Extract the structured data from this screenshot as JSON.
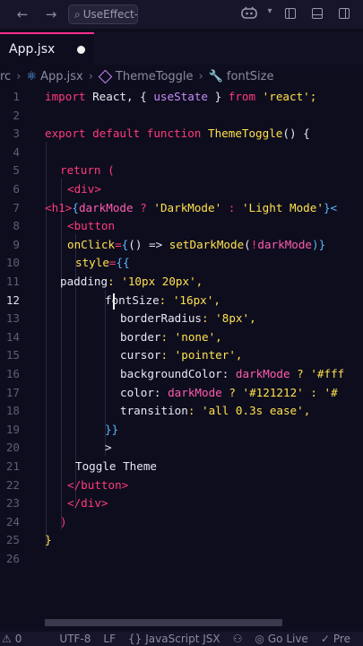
{
  "titlebar": {
    "back_icon": "←",
    "forward_icon": "→",
    "search_text": "UseEffect-ap",
    "copilot_icon": "copilot-icon"
  },
  "tab": {
    "label": "App.jsx"
  },
  "breadcrumb": {
    "folder": "rc",
    "file": "App.jsx",
    "component": "ThemeToggle",
    "prop": "fontSize"
  },
  "editor": {
    "current_line": 12,
    "line_numbers": [
      "1",
      "2",
      "3",
      "4",
      "5",
      "6",
      "7",
      "8",
      "9",
      "10",
      "11",
      "12",
      "13",
      "14",
      "15",
      "16",
      "17",
      "18",
      "19",
      "20",
      "21",
      "22",
      "23",
      "24",
      "25",
      "26"
    ]
  },
  "code": {
    "l1_import": "import",
    "l1_react": " React, { ",
    "l1_usestate": "useState",
    "l1_close": " } ",
    "l1_from": "from",
    "l1_str": " 'react';",
    "l3_export": "export default function ",
    "l3_name": "ThemeToggle",
    "l3_rest": "() {",
    "l5_return": "return",
    "l5_paren": " (",
    "l6_div": "<div>",
    "l7_h1open": "<h1>",
    "l7_brace": "{",
    "l7_var": "darkMode",
    "l7_q": " ? ",
    "l7_s1": "'DarkMode'",
    "l7_c": " : ",
    "l7_s2": "'Light Mode'",
    "l7_close": "}<",
    "l8_button": "<button",
    "l9_onclick": "onClick",
    "l9_eq": "=",
    "l9_b1": "{",
    "l9_arrow": "() => ",
    "l9_fn": "setDarkMode",
    "l9_p": "(",
    "l9_not": "!",
    "l9_var": "darkMode",
    "l9_end": ")}",
    "l10_style": "style",
    "l10_eq": "=",
    "l10_b": "{{",
    "l11_key": "padding",
    "l11_val": ": '10px 20px',",
    "l12_key": "fontSize",
    "l12_val": ": '16px',",
    "l13_key": "borderRadius",
    "l13_val": ": '8px',",
    "l14_key": "border",
    "l14_val": ": 'none',",
    "l15_key": "cursor",
    "l15_val": ": 'pointer',",
    "l16_key": "backgroundColor",
    "l16_colon": ": ",
    "l16_var": "darkMode",
    "l16_rest": " ? '#fff",
    "l17_key": "color",
    "l17_colon": ": ",
    "l17_var": "darkMode",
    "l17_rest": " ? '#121212' : '#",
    "l18_key": "transition",
    "l18_val": ": 'all 0.3s ease',",
    "l19_close": "}}",
    "l20_gt": ">",
    "l21_text": "Toggle Theme",
    "l22_close": "</button>",
    "l23_close": "</div>",
    "l24_paren": ")",
    "l25_brace": "}"
  },
  "statusbar": {
    "errors": "0",
    "encoding": "UTF-8",
    "eol": "LF",
    "language": "JavaScript JSX",
    "golive": "Go Live",
    "prettier": "Pre"
  },
  "colors": {
    "background": "#0e0d1e",
    "keyword": "#ff3b7a",
    "string": "#ffe14d",
    "tab_accent": "#ff2f8f"
  }
}
